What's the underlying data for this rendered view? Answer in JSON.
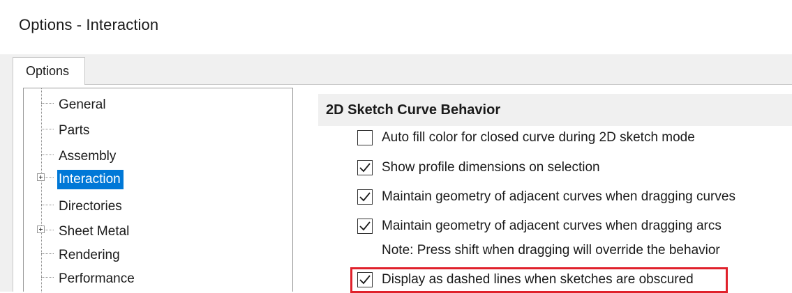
{
  "window": {
    "title": "Options - Interaction"
  },
  "tabs": [
    {
      "label": "Options",
      "active": true
    }
  ],
  "tree": {
    "items": [
      {
        "label": "General",
        "expandable": false,
        "selected": false
      },
      {
        "label": "Parts",
        "expandable": false,
        "selected": false
      },
      {
        "label": "Assembly",
        "expandable": false,
        "selected": false
      },
      {
        "label": "Interaction",
        "expandable": true,
        "selected": true
      },
      {
        "label": "Directories",
        "expandable": false,
        "selected": false
      },
      {
        "label": "Sheet Metal",
        "expandable": true,
        "selected": false
      },
      {
        "label": "Rendering",
        "expandable": false,
        "selected": false
      },
      {
        "label": "Performance",
        "expandable": false,
        "selected": false
      }
    ]
  },
  "section": {
    "title": "2D Sketch Curve Behavior",
    "options": [
      {
        "label": "Auto fill color for closed curve during 2D sketch mode",
        "checked": false
      },
      {
        "label": "Show profile dimensions on selection",
        "checked": true
      },
      {
        "label": "Maintain geometry of adjacent curves when dragging curves",
        "checked": true
      },
      {
        "label": "Maintain geometry of adjacent curves when dragging arcs",
        "checked": true
      },
      {
        "label": "Display as dashed lines when sketches are obscured",
        "checked": true,
        "highlighted": true
      }
    ],
    "note": "Note: Press shift when dragging will override the behavior"
  },
  "colors": {
    "selection": "#0078d7",
    "highlight_box": "#e0212b",
    "section_background": "#f0f0f0"
  },
  "icons": {
    "expander": "plus-box-icon",
    "checkmark": "checkmark-icon"
  }
}
